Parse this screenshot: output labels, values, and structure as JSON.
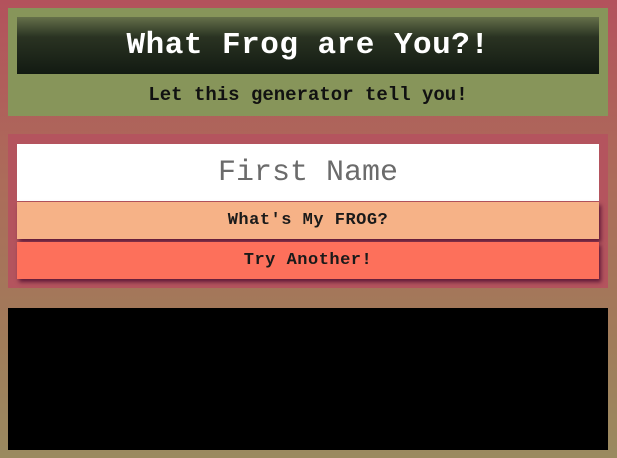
{
  "header": {
    "title": "What Frog are You?!",
    "subtitle": "Let this generator tell you!"
  },
  "form": {
    "name_placeholder": "First Name",
    "name_value": "",
    "frog_button_label": "What's My FROG?",
    "try_button_label": "Try Another!"
  },
  "result": {
    "text": ""
  },
  "colors": {
    "background_top": "#b3525c",
    "background_bottom": "#9a8a60",
    "header_panel": "#87955a",
    "title_bar": "#121a12",
    "form_panel": "#b4545e",
    "frog_button": "#f6b287",
    "try_button": "#fd705b",
    "result_panel": "#000000"
  }
}
